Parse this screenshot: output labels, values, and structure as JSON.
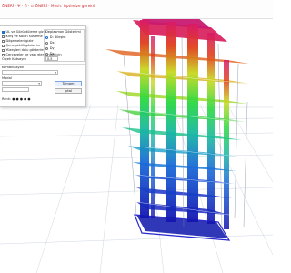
{
  "toolbar": {
    "status_text": "ÖNERİ · Ψ · Π · ∅ ÖNERİ · Mesh: Optimize gerekli"
  },
  "dialog": {
    "options": [
      {
        "label": "UL ve Görüntüleme gizle",
        "checked": true
      },
      {
        "label": "Kiriş ve Kolon süsleme",
        "checked": false
      },
      {
        "label": "Döşemeleri gizle",
        "checked": false
      },
      {
        "label": "Çene şekilli gösterim",
        "checked": false
      },
      {
        "label": "Yüzeyleri dolu gösterim",
        "checked": false
      },
      {
        "label": "Çerçeveler ve yapı elemanları için",
        "checked": false
      }
    ],
    "scale_label": "Ölçek Katsayısı",
    "scale_value": "0.5",
    "display_group_title": "Deplasman Gösterimi",
    "radios": [
      {
        "label": "D: Bileşke",
        "selected": true
      },
      {
        "label": "Dx",
        "selected": false
      },
      {
        "label": "Dy",
        "selected": false
      },
      {
        "label": "Dz",
        "selected": false
      }
    ],
    "combo_label": "Kombinasyon",
    "combo_value": "",
    "mode_label": "Modal",
    "mode_value": "",
    "step_value": "",
    "ok_label": "Tamam",
    "cancel_label": "İptal",
    "footer_text": "Renk: ● ● ● ● ●"
  },
  "legend_colors": [
    "#1a1ab8",
    "#1a8adb",
    "#1ac85a",
    "#c8d81a",
    "#d81a50"
  ]
}
